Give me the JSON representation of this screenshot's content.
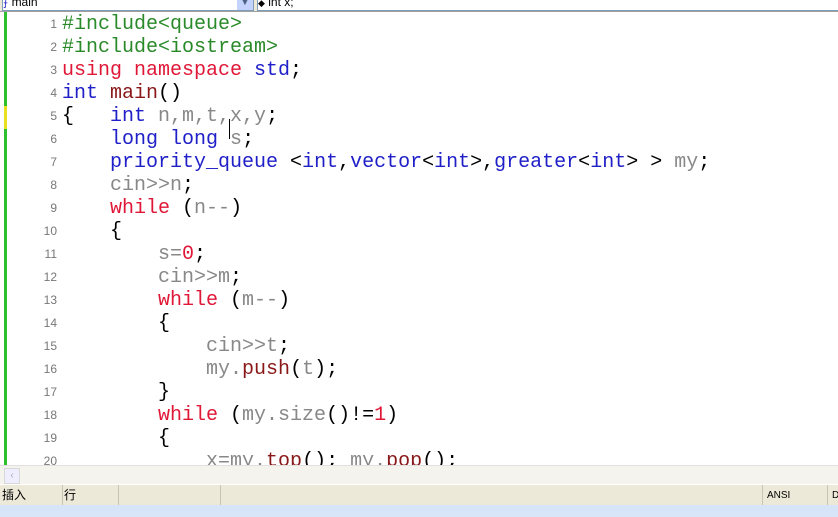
{
  "toolbar": {
    "scope_dropdown": "main",
    "member_dropdown": "int x;"
  },
  "editor": {
    "lines": [
      [
        [
          "#include<queue>",
          "pp"
        ]
      ],
      [
        [
          "#include<iostream>",
          "pp"
        ]
      ],
      [
        [
          "using namespace ",
          "rd"
        ],
        [
          "std",
          "kw"
        ],
        [
          ";",
          "p"
        ]
      ],
      [
        [
          "int ",
          "kw"
        ],
        [
          "main",
          "fn"
        ],
        [
          "()",
          "p"
        ]
      ],
      [
        [
          "{   ",
          "p"
        ],
        [
          "int ",
          "kw"
        ],
        [
          "n,m,t,x,y",
          "vr"
        ],
        [
          ";",
          "p"
        ]
      ],
      [
        [
          "    ",
          "p"
        ],
        [
          "long long ",
          "kw"
        ],
        [
          "s",
          "vr"
        ],
        [
          ";",
          "p"
        ]
      ],
      [
        [
          "    ",
          "p"
        ],
        [
          "priority_queue ",
          "kw"
        ],
        [
          "<",
          "p"
        ],
        [
          "int",
          "kw"
        ],
        [
          ",",
          "p"
        ],
        [
          "vector",
          "kw"
        ],
        [
          "<",
          "p"
        ],
        [
          "int",
          "kw"
        ],
        [
          ">,",
          "p"
        ],
        [
          "greater",
          "kw"
        ],
        [
          "<",
          "p"
        ],
        [
          "int",
          "kw"
        ],
        [
          "> > ",
          "p"
        ],
        [
          "my",
          "vr"
        ],
        [
          ";",
          "p"
        ]
      ],
      [
        [
          "    ",
          "p"
        ],
        [
          "cin>>n",
          "vr"
        ],
        [
          ";",
          "p"
        ]
      ],
      [
        [
          "    ",
          "p"
        ],
        [
          "while ",
          "rd"
        ],
        [
          "(",
          "p"
        ],
        [
          "n--",
          "vr"
        ],
        [
          ")",
          "p"
        ]
      ],
      [
        [
          "    {",
          "p"
        ]
      ],
      [
        [
          "        ",
          "p"
        ],
        [
          "s=",
          "vr"
        ],
        [
          "0",
          "nm"
        ],
        [
          ";",
          "p"
        ]
      ],
      [
        [
          "        ",
          "p"
        ],
        [
          "cin>>m",
          "vr"
        ],
        [
          ";",
          "p"
        ]
      ],
      [
        [
          "        ",
          "p"
        ],
        [
          "while ",
          "rd"
        ],
        [
          "(",
          "p"
        ],
        [
          "m--",
          "vr"
        ],
        [
          ")",
          "p"
        ]
      ],
      [
        [
          "        {",
          "p"
        ]
      ],
      [
        [
          "            ",
          "p"
        ],
        [
          "cin>>t",
          "vr"
        ],
        [
          ";",
          "p"
        ]
      ],
      [
        [
          "            ",
          "p"
        ],
        [
          "my.",
          "vr"
        ],
        [
          "push",
          "fn"
        ],
        [
          "(",
          "p"
        ],
        [
          "t",
          "vr"
        ],
        [
          ");",
          "p"
        ]
      ],
      [
        [
          "        }",
          "p"
        ]
      ],
      [
        [
          "        ",
          "p"
        ],
        [
          "while ",
          "rd"
        ],
        [
          "(",
          "p"
        ],
        [
          "my.size",
          "vr"
        ],
        [
          "()!=",
          "p"
        ],
        [
          "1",
          "nm"
        ],
        [
          ")",
          "p"
        ]
      ],
      [
        [
          "        {",
          "p"
        ]
      ],
      [
        [
          "            ",
          "p"
        ],
        [
          "x=my.",
          "vr"
        ],
        [
          "top",
          "fn"
        ],
        [
          "(); ",
          "p"
        ],
        [
          "my.",
          "vr"
        ],
        [
          "pop",
          "fn"
        ],
        [
          "();",
          "p"
        ]
      ]
    ]
  },
  "statusbar": {
    "mode": "插入",
    "line_label": "行",
    "encoding": "ANSI",
    "extra": "D"
  }
}
